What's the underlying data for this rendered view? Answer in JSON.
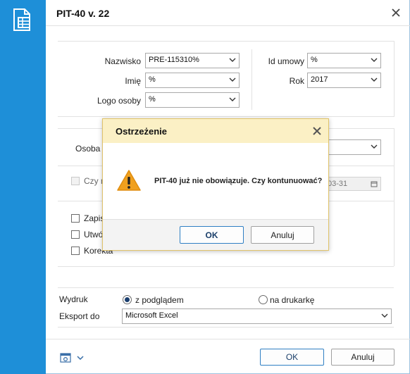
{
  "window": {
    "title": "PIT-40 v. 22"
  },
  "filters": {
    "nazwisko_label": "Nazwisko",
    "nazwisko_value": "PRE-115310%",
    "imie_label": "Imię",
    "imie_value": "%",
    "logo_label": "Logo osoby",
    "logo_value": "%",
    "id_umowy_label": "Id umowy",
    "id_umowy_value": "%",
    "rok_label": "Rok",
    "rok_value": "2017"
  },
  "options": {
    "osoba_label_partial": "Osoba p",
    "czy_label_partial": "Czy r",
    "date_partial": "03-31",
    "zapis_partial": "Zapis",
    "utworz_partial": "Utwó",
    "korekta_label": "Korekta"
  },
  "output": {
    "wydruk_label": "Wydruk",
    "preview_option": "z podglądem",
    "printer_option": "na drukarkę",
    "selected": "z podglądem",
    "eksport_label": "Eksport do",
    "eksport_value": "Microsoft Excel"
  },
  "footer": {
    "ok_label": "OK",
    "cancel_label": "Anuluj"
  },
  "dialog": {
    "title": "Ostrzeżenie",
    "message": "PIT-40 już nie obowiązuje. Czy kontunuować?",
    "ok_label": "OK",
    "cancel_label": "Anuluj"
  },
  "colors": {
    "sidebar": "#1e8fd8",
    "dialog_header": "#fbf0c5",
    "warning": "#f0a01e",
    "primary_border": "#2f7fc4"
  }
}
